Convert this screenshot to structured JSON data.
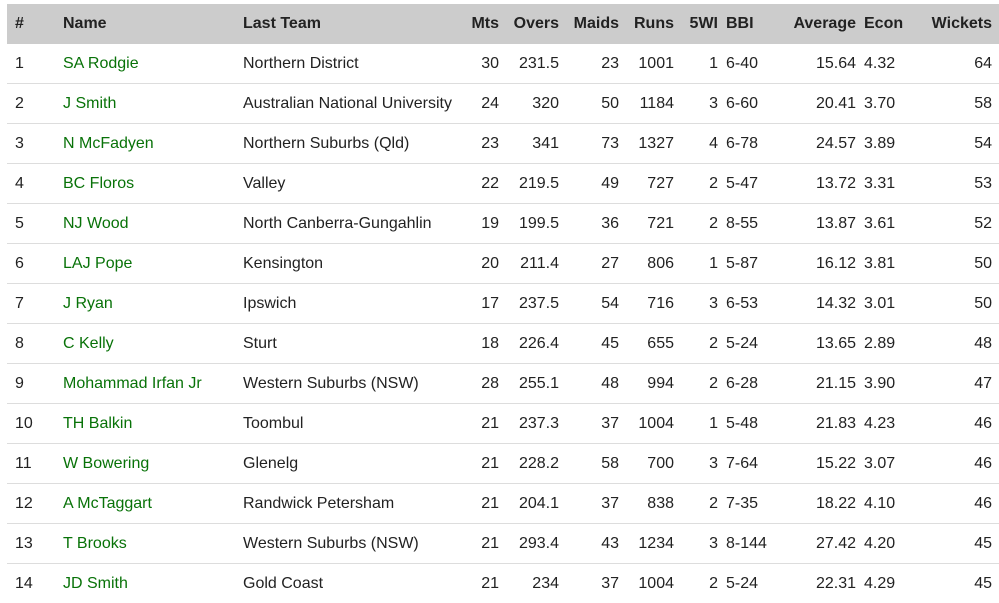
{
  "colors": {
    "header_bg": "#cccccc",
    "link": "#087208",
    "row_border": "#dddddd",
    "text": "#222222"
  },
  "table": {
    "headers": {
      "rank": "#",
      "name": "Name",
      "last_team": "Last Team",
      "mts": "Mts",
      "overs": "Overs",
      "maids": "Maids",
      "runs": "Runs",
      "five_wi": "5WI",
      "bbi": "BBI",
      "average": "Average",
      "econ": "Econ",
      "wickets": "Wickets"
    },
    "rows": [
      {
        "rank": "1",
        "name": "SA Rodgie",
        "last_team": "Northern District",
        "mts": "30",
        "overs": "231.5",
        "maids": "23",
        "runs": "1001",
        "five_wi": "1",
        "bbi": "6-40",
        "average": "15.64",
        "econ": "4.32",
        "wickets": "64"
      },
      {
        "rank": "2",
        "name": "J Smith",
        "last_team": "Australian National University",
        "mts": "24",
        "overs": "320",
        "maids": "50",
        "runs": "1184",
        "five_wi": "3",
        "bbi": "6-60",
        "average": "20.41",
        "econ": "3.70",
        "wickets": "58"
      },
      {
        "rank": "3",
        "name": "N McFadyen",
        "last_team": "Northern Suburbs (Qld)",
        "mts": "23",
        "overs": "341",
        "maids": "73",
        "runs": "1327",
        "five_wi": "4",
        "bbi": "6-78",
        "average": "24.57",
        "econ": "3.89",
        "wickets": "54"
      },
      {
        "rank": "4",
        "name": "BC Floros",
        "last_team": "Valley",
        "mts": "22",
        "overs": "219.5",
        "maids": "49",
        "runs": "727",
        "five_wi": "2",
        "bbi": "5-47",
        "average": "13.72",
        "econ": "3.31",
        "wickets": "53"
      },
      {
        "rank": "5",
        "name": "NJ Wood",
        "last_team": "North Canberra-Gungahlin",
        "mts": "19",
        "overs": "199.5",
        "maids": "36",
        "runs": "721",
        "five_wi": "2",
        "bbi": "8-55",
        "average": "13.87",
        "econ": "3.61",
        "wickets": "52"
      },
      {
        "rank": "6",
        "name": "LAJ Pope",
        "last_team": "Kensington",
        "mts": "20",
        "overs": "211.4",
        "maids": "27",
        "runs": "806",
        "five_wi": "1",
        "bbi": "5-87",
        "average": "16.12",
        "econ": "3.81",
        "wickets": "50"
      },
      {
        "rank": "7",
        "name": "J Ryan",
        "last_team": "Ipswich",
        "mts": "17",
        "overs": "237.5",
        "maids": "54",
        "runs": "716",
        "five_wi": "3",
        "bbi": "6-53",
        "average": "14.32",
        "econ": "3.01",
        "wickets": "50"
      },
      {
        "rank": "8",
        "name": "C Kelly",
        "last_team": "Sturt",
        "mts": "18",
        "overs": "226.4",
        "maids": "45",
        "runs": "655",
        "five_wi": "2",
        "bbi": "5-24",
        "average": "13.65",
        "econ": "2.89",
        "wickets": "48"
      },
      {
        "rank": "9",
        "name": "Mohammad Irfan Jr",
        "last_team": "Western Suburbs (NSW)",
        "mts": "28",
        "overs": "255.1",
        "maids": "48",
        "runs": "994",
        "five_wi": "2",
        "bbi": "6-28",
        "average": "21.15",
        "econ": "3.90",
        "wickets": "47"
      },
      {
        "rank": "10",
        "name": "TH Balkin",
        "last_team": "Toombul",
        "mts": "21",
        "overs": "237.3",
        "maids": "37",
        "runs": "1004",
        "five_wi": "1",
        "bbi": "5-48",
        "average": "21.83",
        "econ": "4.23",
        "wickets": "46"
      },
      {
        "rank": "11",
        "name": "W Bowering",
        "last_team": "Glenelg",
        "mts": "21",
        "overs": "228.2",
        "maids": "58",
        "runs": "700",
        "five_wi": "3",
        "bbi": "7-64",
        "average": "15.22",
        "econ": "3.07",
        "wickets": "46"
      },
      {
        "rank": "12",
        "name": "A McTaggart",
        "last_team": "Randwick Petersham",
        "mts": "21",
        "overs": "204.1",
        "maids": "37",
        "runs": "838",
        "five_wi": "2",
        "bbi": "7-35",
        "average": "18.22",
        "econ": "4.10",
        "wickets": "46"
      },
      {
        "rank": "13",
        "name": "T Brooks",
        "last_team": "Western Suburbs (NSW)",
        "mts": "21",
        "overs": "293.4",
        "maids": "43",
        "runs": "1234",
        "five_wi": "3",
        "bbi": "8-144",
        "average": "27.42",
        "econ": "4.20",
        "wickets": "45"
      },
      {
        "rank": "14",
        "name": "JD Smith",
        "last_team": "Gold Coast",
        "mts": "21",
        "overs": "234",
        "maids": "37",
        "runs": "1004",
        "five_wi": "2",
        "bbi": "5-24",
        "average": "22.31",
        "econ": "4.29",
        "wickets": "45"
      }
    ]
  }
}
